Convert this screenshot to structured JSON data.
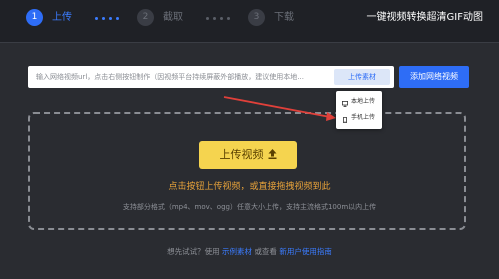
{
  "steps": [
    {
      "number": "1",
      "label": "上传"
    },
    {
      "number": "2",
      "label": "截取"
    },
    {
      "number": "3",
      "label": "下载"
    }
  ],
  "brand_title": "一键视频转换超清GIF动图",
  "url_input": {
    "placeholder": "输入网络视频url，点击右侧按钮制作（因视频平台持续屏蔽外部播放，建议使用本地..."
  },
  "upload_material_button": "上传素材",
  "add_url_button": "添加网络视频",
  "upload_menu": {
    "items": [
      {
        "label": "本地上传",
        "icon": "monitor-icon"
      },
      {
        "label": "手机上传",
        "icon": "phone-icon"
      }
    ]
  },
  "dropzone": {
    "upload_button": "上传视频",
    "hint": "点击按钮上传视频，或直接拖拽视频到此",
    "formats": "支持部分格式（mp4、mov、ogg）任意大小上传，支持主流格式100m以内上传"
  },
  "footer": {
    "prefix": "想先试试？使用",
    "sample_link": "示例素材",
    "middle": "或查看",
    "guide_link": "新用户使用指南"
  },
  "colors": {
    "accent_blue": "#2e6df6",
    "upload_yellow": "#f5d44f",
    "hint_orange": "#e8a33a",
    "annotation_red": "#e0403a",
    "background": "#2a2c31"
  }
}
